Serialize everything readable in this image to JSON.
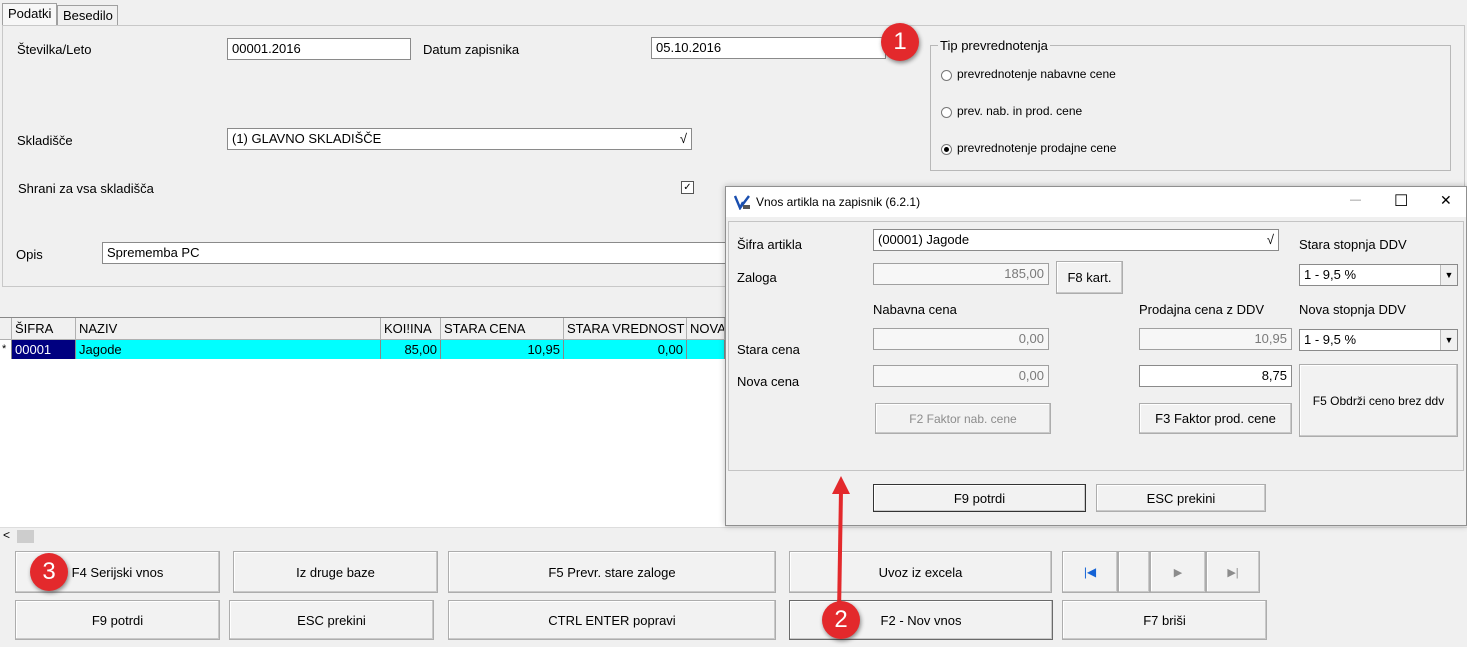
{
  "tabs": {
    "podatki": "Podatki",
    "besedilo": "Besedilo"
  },
  "header": {
    "stevilka_label": "Številka/Leto",
    "stevilka_value": "00001.2016",
    "datum_label": "Datum zapisnika",
    "datum_value": "05.10.2016",
    "skladisce_label": "Skladišče",
    "skladisce_value": "(1) GLAVNO SKLADIŠČE",
    "shrani_label": "Shrani za vsa skladišča",
    "shrani_checked": "✓",
    "opis_label": "Opis",
    "opis_value": "Sprememba PC",
    "dropdown_glyph": "√"
  },
  "tip": {
    "legend": "Tip prevrednotenja",
    "options": [
      "prevrednotenje nabavne cene",
      "prev. nab. in prod. cene",
      "prevrednotenje prodajne cene"
    ]
  },
  "grid": {
    "headers": [
      "ŠIFRA",
      "NAZIV",
      "KOI!INA",
      "STARA CENA",
      "STARA VREDNOST",
      "NOVA"
    ],
    "row": {
      "marker": "*",
      "sifra": "00001",
      "naziv": "Jagode",
      "kolicina": "85,00",
      "stara_cena": "10,95",
      "stara_vrednost": "0,00"
    },
    "scroll_left": "<"
  },
  "buttons": {
    "serijski": "F4 Serijski vnos",
    "druge_baze": "Iz druge baze",
    "prevr_zaloge": "F5 Prevr. stare zaloge",
    "uvoz": "Uvoz iz excela",
    "potrdi": "F9  potrdi",
    "prekini": "ESC  prekini",
    "popravi": "CTRL ENTER popravi",
    "nov_vnos": "F2 - Nov vnos",
    "brisi": "F7 briši",
    "nav_first": "|◀",
    "nav_play": "▶",
    "nav_last": "▶|"
  },
  "dialog": {
    "title": "Vnos artikla na zapisnik  (6.2.1)",
    "sifra_label": "Šifra artikla",
    "sifra_value": "(00001) Jagode",
    "zaloga_label": "Zaloga",
    "zaloga_value": "185,00",
    "f8_button": "F8 kart.",
    "stara_ddv_label": "Stara stopnja DDV",
    "stara_ddv_value": "1 -  9,5 %",
    "nabavna_label": "Nabavna cena",
    "prodajna_label": "Prodajna cena z DDV",
    "nova_ddv_label": "Nova stopnja DDV",
    "nova_ddv_value": "1 -  9,5 %",
    "stara_cena_label": "Stara  cena",
    "nova_cena_label": "Nova  cena",
    "stara_nab": "0,00",
    "stara_prod": "10,95",
    "nova_nab": "0,00",
    "nova_prod": "8,75",
    "f2_button": "F2 Faktor nab. cene",
    "f3_button": "F3 Faktor prod. cene",
    "f5_button": "F5 Obdrži ceno brez ddv",
    "f9_button": "F9  potrdi",
    "esc_button": "ESC  prekini",
    "minimize": "—",
    "maximize": "☐",
    "close": "✕"
  },
  "annotations": {
    "one": "1",
    "two": "2",
    "three": "3"
  },
  "colors": {
    "selection_row": "#00ffff",
    "selected_cell": "#000080",
    "badge": "#e3292c"
  }
}
